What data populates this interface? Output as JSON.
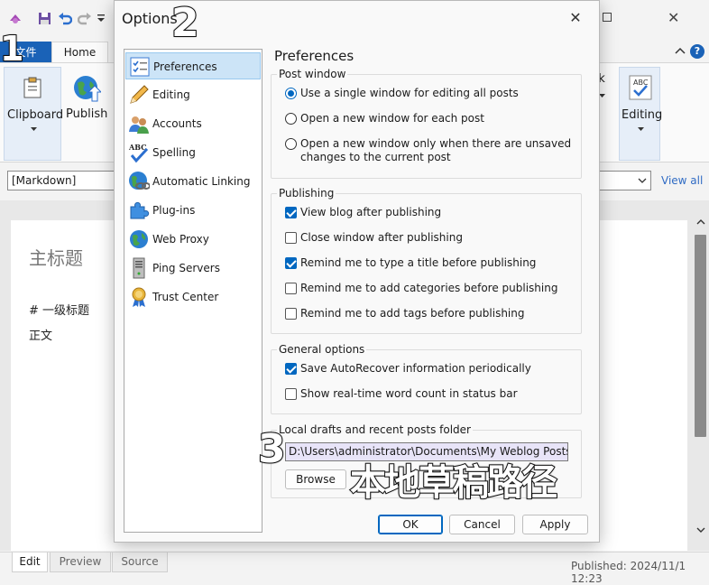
{
  "app": {
    "title_bar": {
      "close_glyph": "✕"
    },
    "ribbon": {
      "file_tab": "文件",
      "home_tab": "Home",
      "clipboard_label": "Clipboard",
      "publish_label": "Publish",
      "link_label_partial": "nk",
      "editing_label": "Editing"
    },
    "source_select_value": "[Markdown]",
    "view_all": "View all",
    "document": {
      "title": "主标题",
      "heading_line": "# 一级标题",
      "body_line": "正文"
    },
    "bottom_tabs": [
      "Edit",
      "Preview",
      "Source"
    ],
    "status": "Published: 2024/11/1 12:23"
  },
  "dialog": {
    "title": "Options",
    "categories": [
      {
        "label": "Preferences",
        "icon": "preferences-icon",
        "selected": true
      },
      {
        "label": "Editing",
        "icon": "pencil-icon"
      },
      {
        "label": "Accounts",
        "icon": "accounts-icon"
      },
      {
        "label": "Spelling",
        "icon": "spelling-icon"
      },
      {
        "label": "Automatic Linking",
        "icon": "globe-link-icon"
      },
      {
        "label": "Plug-ins",
        "icon": "puzzle-icon"
      },
      {
        "label": "Web Proxy",
        "icon": "globe-icon"
      },
      {
        "label": "Ping Servers",
        "icon": "server-icon"
      },
      {
        "label": "Trust Center",
        "icon": "medal-icon"
      }
    ],
    "heading": "Preferences",
    "post_window": {
      "legend": "Post window",
      "options": [
        {
          "label": "Use a single window for editing all posts",
          "selected": true
        },
        {
          "label": "Open a new window for each post",
          "selected": false
        },
        {
          "label": "Open a new window only when there are unsaved",
          "label2": "changes to the current post",
          "selected": false
        }
      ]
    },
    "publishing": {
      "legend": "Publishing",
      "options": [
        {
          "label": "View blog after publishing",
          "checked": true
        },
        {
          "label": "Close window after publishing",
          "checked": false
        },
        {
          "label": "Remind me to type a title before publishing",
          "checked": true
        },
        {
          "label": "Remind me to add categories before publishing",
          "checked": false
        },
        {
          "label": "Remind me to add tags before publishing",
          "checked": false
        }
      ]
    },
    "general": {
      "legend": "General options",
      "options": [
        {
          "label": "Save AutoRecover information periodically",
          "checked": true
        },
        {
          "label": "Show real-time word count in status bar",
          "checked": false
        }
      ]
    },
    "drafts": {
      "legend": "Local drafts and recent posts folder",
      "path": "D:\\Users\\administrator\\Documents\\My Weblog Posts",
      "browse": "Browse"
    },
    "buttons": {
      "ok": "OK",
      "cancel": "Cancel",
      "apply": "Apply"
    }
  },
  "annotations": {
    "n1": "1",
    "n2": "2",
    "n3": "3",
    "note": "本地草稿路径"
  }
}
